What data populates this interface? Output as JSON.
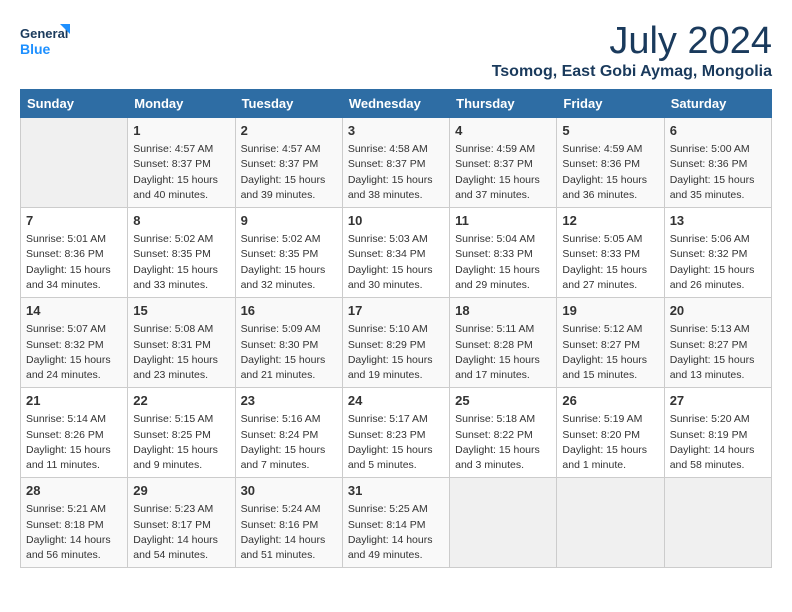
{
  "header": {
    "logo_line1": "General",
    "logo_line2": "Blue",
    "month_year": "July 2024",
    "location": "Tsomog, East Gobi Aymag, Mongolia"
  },
  "days_of_week": [
    "Sunday",
    "Monday",
    "Tuesday",
    "Wednesday",
    "Thursday",
    "Friday",
    "Saturday"
  ],
  "weeks": [
    [
      {
        "day": "",
        "info": ""
      },
      {
        "day": "1",
        "info": "Sunrise: 4:57 AM\nSunset: 8:37 PM\nDaylight: 15 hours\nand 40 minutes."
      },
      {
        "day": "2",
        "info": "Sunrise: 4:57 AM\nSunset: 8:37 PM\nDaylight: 15 hours\nand 39 minutes."
      },
      {
        "day": "3",
        "info": "Sunrise: 4:58 AM\nSunset: 8:37 PM\nDaylight: 15 hours\nand 38 minutes."
      },
      {
        "day": "4",
        "info": "Sunrise: 4:59 AM\nSunset: 8:37 PM\nDaylight: 15 hours\nand 37 minutes."
      },
      {
        "day": "5",
        "info": "Sunrise: 4:59 AM\nSunset: 8:36 PM\nDaylight: 15 hours\nand 36 minutes."
      },
      {
        "day": "6",
        "info": "Sunrise: 5:00 AM\nSunset: 8:36 PM\nDaylight: 15 hours\nand 35 minutes."
      }
    ],
    [
      {
        "day": "7",
        "info": "Sunrise: 5:01 AM\nSunset: 8:36 PM\nDaylight: 15 hours\nand 34 minutes."
      },
      {
        "day": "8",
        "info": "Sunrise: 5:02 AM\nSunset: 8:35 PM\nDaylight: 15 hours\nand 33 minutes."
      },
      {
        "day": "9",
        "info": "Sunrise: 5:02 AM\nSunset: 8:35 PM\nDaylight: 15 hours\nand 32 minutes."
      },
      {
        "day": "10",
        "info": "Sunrise: 5:03 AM\nSunset: 8:34 PM\nDaylight: 15 hours\nand 30 minutes."
      },
      {
        "day": "11",
        "info": "Sunrise: 5:04 AM\nSunset: 8:33 PM\nDaylight: 15 hours\nand 29 minutes."
      },
      {
        "day": "12",
        "info": "Sunrise: 5:05 AM\nSunset: 8:33 PM\nDaylight: 15 hours\nand 27 minutes."
      },
      {
        "day": "13",
        "info": "Sunrise: 5:06 AM\nSunset: 8:32 PM\nDaylight: 15 hours\nand 26 minutes."
      }
    ],
    [
      {
        "day": "14",
        "info": "Sunrise: 5:07 AM\nSunset: 8:32 PM\nDaylight: 15 hours\nand 24 minutes."
      },
      {
        "day": "15",
        "info": "Sunrise: 5:08 AM\nSunset: 8:31 PM\nDaylight: 15 hours\nand 23 minutes."
      },
      {
        "day": "16",
        "info": "Sunrise: 5:09 AM\nSunset: 8:30 PM\nDaylight: 15 hours\nand 21 minutes."
      },
      {
        "day": "17",
        "info": "Sunrise: 5:10 AM\nSunset: 8:29 PM\nDaylight: 15 hours\nand 19 minutes."
      },
      {
        "day": "18",
        "info": "Sunrise: 5:11 AM\nSunset: 8:28 PM\nDaylight: 15 hours\nand 17 minutes."
      },
      {
        "day": "19",
        "info": "Sunrise: 5:12 AM\nSunset: 8:27 PM\nDaylight: 15 hours\nand 15 minutes."
      },
      {
        "day": "20",
        "info": "Sunrise: 5:13 AM\nSunset: 8:27 PM\nDaylight: 15 hours\nand 13 minutes."
      }
    ],
    [
      {
        "day": "21",
        "info": "Sunrise: 5:14 AM\nSunset: 8:26 PM\nDaylight: 15 hours\nand 11 minutes."
      },
      {
        "day": "22",
        "info": "Sunrise: 5:15 AM\nSunset: 8:25 PM\nDaylight: 15 hours\nand 9 minutes."
      },
      {
        "day": "23",
        "info": "Sunrise: 5:16 AM\nSunset: 8:24 PM\nDaylight: 15 hours\nand 7 minutes."
      },
      {
        "day": "24",
        "info": "Sunrise: 5:17 AM\nSunset: 8:23 PM\nDaylight: 15 hours\nand 5 minutes."
      },
      {
        "day": "25",
        "info": "Sunrise: 5:18 AM\nSunset: 8:22 PM\nDaylight: 15 hours\nand 3 minutes."
      },
      {
        "day": "26",
        "info": "Sunrise: 5:19 AM\nSunset: 8:20 PM\nDaylight: 15 hours\nand 1 minute."
      },
      {
        "day": "27",
        "info": "Sunrise: 5:20 AM\nSunset: 8:19 PM\nDaylight: 14 hours\nand 58 minutes."
      }
    ],
    [
      {
        "day": "28",
        "info": "Sunrise: 5:21 AM\nSunset: 8:18 PM\nDaylight: 14 hours\nand 56 minutes."
      },
      {
        "day": "29",
        "info": "Sunrise: 5:23 AM\nSunset: 8:17 PM\nDaylight: 14 hours\nand 54 minutes."
      },
      {
        "day": "30",
        "info": "Sunrise: 5:24 AM\nSunset: 8:16 PM\nDaylight: 14 hours\nand 51 minutes."
      },
      {
        "day": "31",
        "info": "Sunrise: 5:25 AM\nSunset: 8:14 PM\nDaylight: 14 hours\nand 49 minutes."
      },
      {
        "day": "",
        "info": ""
      },
      {
        "day": "",
        "info": ""
      },
      {
        "day": "",
        "info": ""
      }
    ]
  ]
}
